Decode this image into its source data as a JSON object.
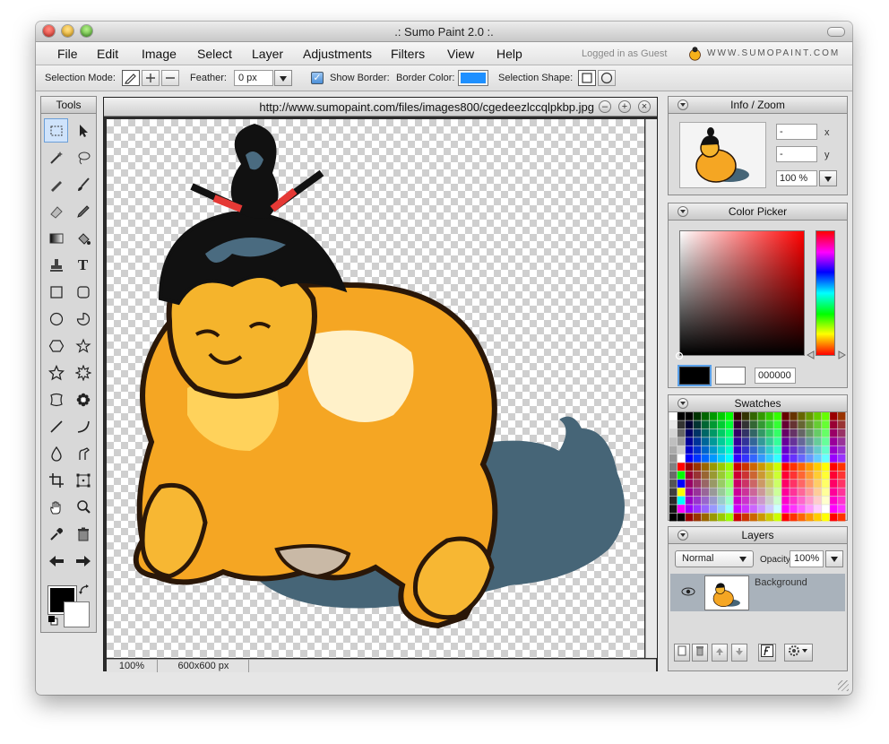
{
  "window": {
    "title": ".: Sumo Paint 2.0 :."
  },
  "menu": [
    "File",
    "Edit",
    "Image",
    "Select",
    "Layer",
    "Adjustments",
    "Filters",
    "View",
    "Help"
  ],
  "status": {
    "logged_in": "Logged in as Guest"
  },
  "brand": {
    "url_text": "WWW.SUMOPAINT.COM"
  },
  "toolbar": {
    "selection_mode_label": "Selection Mode:",
    "feather_label": "Feather:",
    "feather_value": "0 px",
    "show_border_label": "Show Border:",
    "show_border_checked": true,
    "border_color_label": "Border Color:",
    "border_color": "#1e90ff",
    "selection_shape_label": "Selection Shape:"
  },
  "tools": {
    "title": "Tools",
    "items": [
      "rect-select",
      "move",
      "magic-wand",
      "lasso",
      "pen",
      "brush",
      "eraser",
      "pencil",
      "gradient",
      "fill",
      "stamp",
      "text",
      "rectangle",
      "rounded-rectangle",
      "ellipse",
      "pie",
      "hexagon",
      "star",
      "star-outline",
      "burst",
      "blob",
      "flower",
      "line",
      "curve",
      "blur",
      "smudge",
      "crop",
      "transform",
      "hand",
      "zoom",
      "eyedropper",
      "trash",
      "arrow-left",
      "arrow-right"
    ],
    "fg_color": "#000000",
    "bg_color": "#ffffff"
  },
  "document": {
    "title": "http://www.sumopaint.com/files/images800/cgedeezlccqlpkbp.jpg",
    "zoom": "100%",
    "dimensions": "600x600 px"
  },
  "info_zoom": {
    "title": "Info / Zoom",
    "x_value": "-",
    "y_value": "-",
    "x_label": "x",
    "y_label": "y",
    "zoom": "100 %"
  },
  "color_picker": {
    "title": "Color Picker",
    "hex": "000000",
    "current": "#000000",
    "previous": "#ffffff"
  },
  "swatches": {
    "title": "Swatches"
  },
  "layers": {
    "title": "Layers",
    "blend_mode": "Normal",
    "opacity_label": "Opacity:",
    "opacity": "100%",
    "items": [
      {
        "name": "Background"
      }
    ]
  }
}
